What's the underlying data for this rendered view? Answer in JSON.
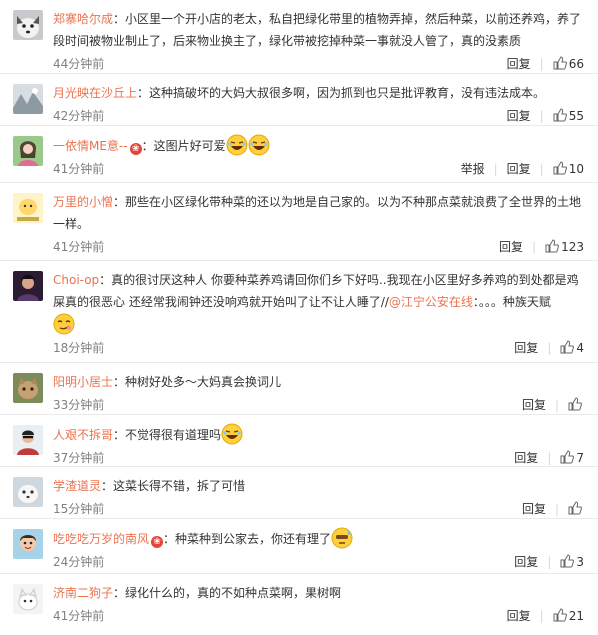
{
  "reply_label": "回复",
  "report_label": "举报",
  "comments": [
    {
      "user": "郑寨哈尔成",
      "text": "：小区里一个开小店的老太，私自把绿化带里的植物弄掉，然后种菜，以前还养鸡，养了段时间被物业制止了，后来物业换主了，绿化带被挖掉种菜一事就没人管了，真的没素质",
      "time": "44分钟前",
      "likes": "66"
    },
    {
      "user": "月光映在沙丘上",
      "text": "：这种搞破坏的大妈大叔很多啊，因为抓到也只是批评教育，没有违法成本。",
      "time": "42分钟前",
      "likes": "55"
    },
    {
      "user": "一依情ME意--",
      "text": "：这图片好可爱",
      "time": "41分钟前",
      "likes": "10"
    },
    {
      "user": "万里的小憎",
      "text": "：那些在小区绿化带种菜的还以为地是自己家的。以为不种那点菜就浪费了全世界的土地一样。",
      "time": "41分钟前",
      "likes": "123"
    },
    {
      "user": "Choi-op",
      "text": "：真的很讨厌这种人 你要种菜养鸡请回你们乡下好吗..我现在小区里好多养鸡的到处都是鸡屎真的很恶心 还经常我闹钟还没响鸡就开始叫了让不让人睡了//",
      "mention": "@江宁公安在线",
      "text2": "：。。。种族天赋",
      "time": "18分钟前",
      "likes": "4"
    },
    {
      "user": "阳明小居士",
      "text": "：种树好处多～大妈真会换词儿",
      "time": "33分钟前",
      "likes": ""
    },
    {
      "user": "人艰不拆哥",
      "text": "：不觉得很有道理吗",
      "time": "37分钟前",
      "likes": "7"
    },
    {
      "user": "学渣道灵",
      "text": "：这菜长得不错，拆了可惜",
      "time": "15分钟前",
      "likes": ""
    },
    {
      "user": "吃吃吃万岁的南风",
      "text": "：种菜种到公家去，你还有理了",
      "time": "24分钟前",
      "likes": "3"
    },
    {
      "user": "济南二狗子",
      "text": "：绿化什么的，真的不如种点菜啊，果树啊",
      "time": "41分钟前",
      "likes": "21"
    }
  ]
}
